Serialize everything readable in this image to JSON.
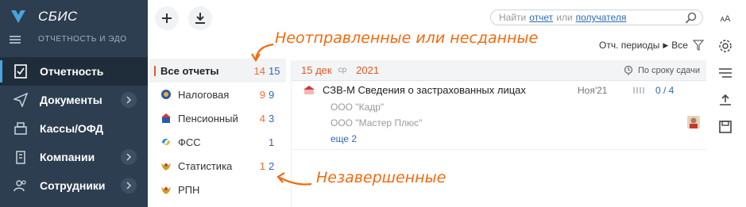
{
  "app": {
    "name": "СБИС",
    "section": "ОТЧЕТНОСТЬ И ЭДО"
  },
  "sidebar": {
    "items": [
      {
        "label": "Отчетность",
        "icon": "report-icon",
        "active": true
      },
      {
        "label": "Документы",
        "icon": "paper-plane-icon",
        "chevron": true
      },
      {
        "label": "Кассы/ОФД",
        "icon": "cash-register-icon"
      },
      {
        "label": "Компании",
        "icon": "building-icon",
        "chevron": true
      },
      {
        "label": "Сотрудники",
        "icon": "people-icon",
        "chevron": true
      }
    ]
  },
  "toolbar": {
    "add_icon": "plus-icon",
    "download_icon": "download-icon"
  },
  "search": {
    "prefix": "Найти",
    "link1": "отчет",
    "middle": "или",
    "link2": "получателя"
  },
  "periods": {
    "label": "Отч. периоды",
    "value": "Все"
  },
  "filters": {
    "items": [
      {
        "label": "Все отчеты",
        "count1": "14",
        "count2": "15",
        "selected": true
      },
      {
        "label": "Налоговая",
        "count1": "9",
        "count2": "9",
        "icon": "tax-emblem-icon"
      },
      {
        "label": "Пенсионный",
        "count1": "4",
        "count2": "3",
        "icon": "pension-fund-icon"
      },
      {
        "label": "ФСС",
        "count1": "",
        "count2": "1",
        "icon": "fss-emblem-icon"
      },
      {
        "label": "Статистика",
        "count1": "1",
        "count2": "2",
        "icon": "eagle-emblem-icon"
      },
      {
        "label": "РПН",
        "count1": "",
        "count2": "",
        "icon": "eagle-emblem-icon"
      }
    ]
  },
  "list": {
    "date": {
      "day": "15 дек",
      "weekday": "ср",
      "year": "2021"
    },
    "sort_label": "По сроку сдачи",
    "rows": [
      {
        "title": "СЗВ-М Сведения о застрахованных лицах",
        "period": "Ноя'21",
        "progress": "0 / 4",
        "orgs": [
          "ООО \"Кадр\"",
          "ООО \"Мастер Плюс\""
        ],
        "more": "еще 2"
      }
    ]
  },
  "annotations": {
    "top": "Неотправленные или несданные",
    "bottom": "Незавершенные"
  },
  "colors": {
    "sidebar": "#2d3e50",
    "accent": "#f26a2e",
    "link": "#2a6ab8"
  }
}
